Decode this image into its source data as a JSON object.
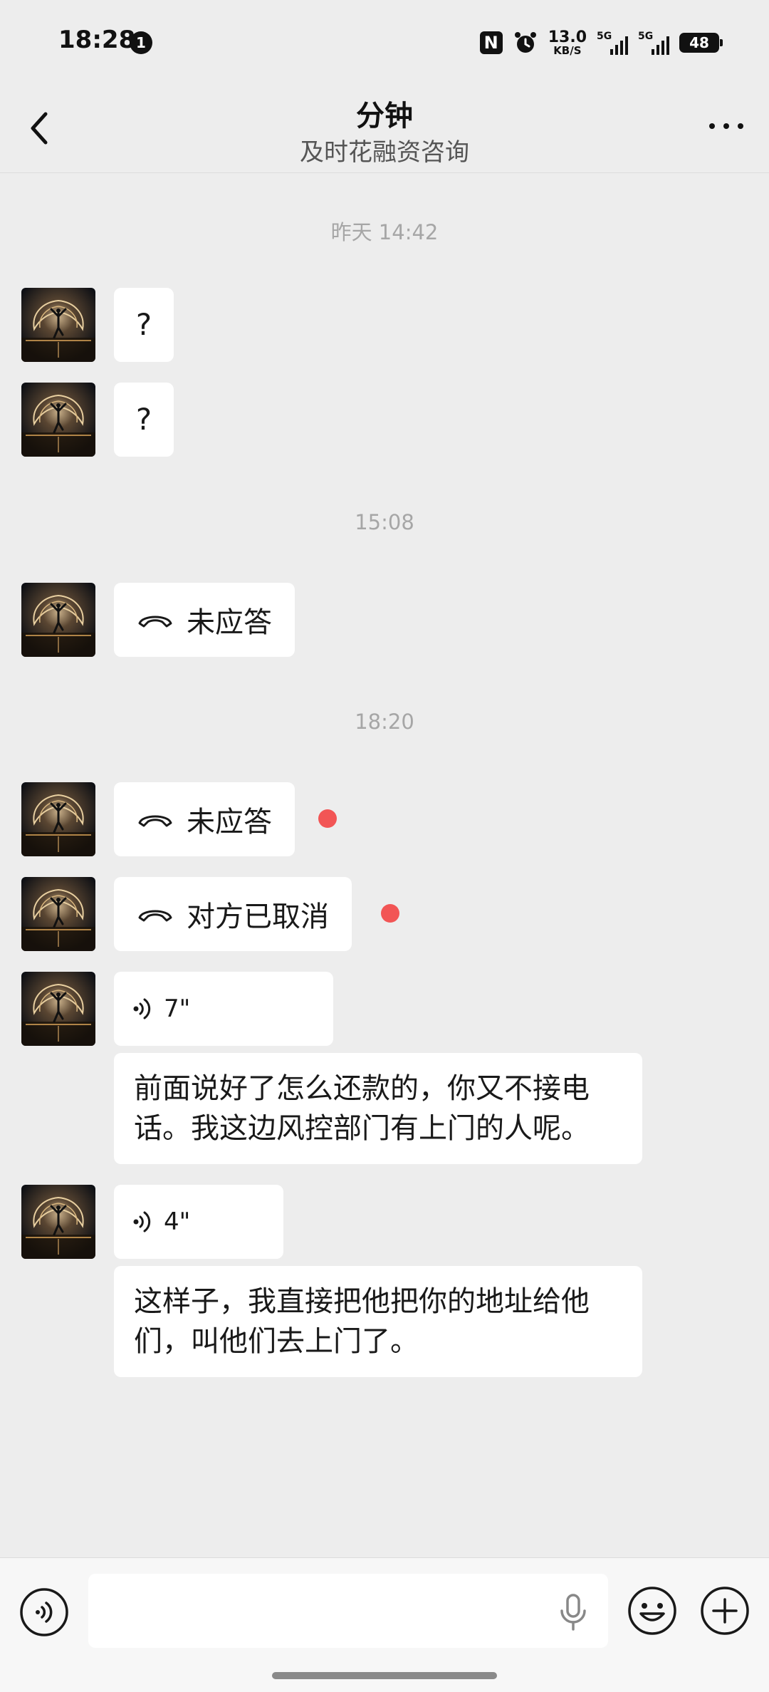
{
  "status_bar": {
    "time": "18:28",
    "notification_count": "1",
    "nfc": "N",
    "speed_value": "13.0",
    "speed_unit": "KB/S",
    "sim1_label": "5G",
    "sim2_label": "5G",
    "battery": "48"
  },
  "header": {
    "title": "分钟",
    "subtitle": "及时花融资咨询"
  },
  "messages": {
    "ts1": "昨天 14:42",
    "q1": "?",
    "q2": "?",
    "ts2": "15:08",
    "call1": "未应答",
    "ts3": "18:20",
    "call2": "未应答",
    "call3": "对方已取消",
    "voice1": "7\"",
    "text1": "前面说好了怎么还款的，你又不接电话。我这边风控部门有上门的人呢。",
    "voice2": "4\"",
    "text2": "这样子，我直接把他把你的地址给他们，叫他们去上门了。"
  },
  "colors": {
    "background": "#ededed",
    "bubble": "#ffffff",
    "unread_dot": "#f25555",
    "timestamp": "#a6a6a6"
  },
  "icons": {
    "back": "chevron-left-icon",
    "more": "more-dots-icon",
    "phone": "phone-hangup-icon",
    "voice": "voice-wave-icon",
    "mic": "microphone-icon",
    "emoji": "emoji-icon",
    "plus": "plus-icon"
  }
}
